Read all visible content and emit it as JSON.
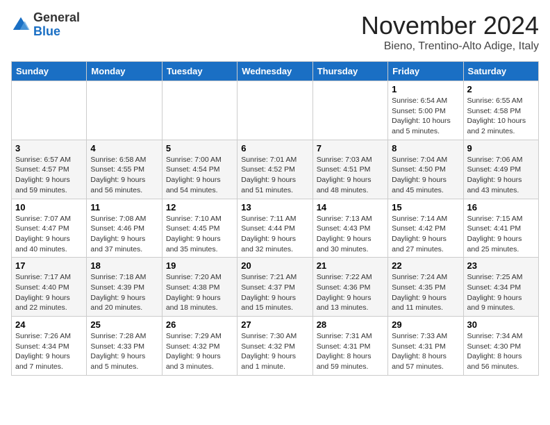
{
  "logo": {
    "general": "General",
    "blue": "Blue"
  },
  "header": {
    "month": "November 2024",
    "location": "Bieno, Trentino-Alto Adige, Italy"
  },
  "days_of_week": [
    "Sunday",
    "Monday",
    "Tuesday",
    "Wednesday",
    "Thursday",
    "Friday",
    "Saturday"
  ],
  "weeks": [
    [
      {
        "day": "",
        "info": ""
      },
      {
        "day": "",
        "info": ""
      },
      {
        "day": "",
        "info": ""
      },
      {
        "day": "",
        "info": ""
      },
      {
        "day": "",
        "info": ""
      },
      {
        "day": "1",
        "info": "Sunrise: 6:54 AM\nSunset: 5:00 PM\nDaylight: 10 hours and 5 minutes."
      },
      {
        "day": "2",
        "info": "Sunrise: 6:55 AM\nSunset: 4:58 PM\nDaylight: 10 hours and 2 minutes."
      }
    ],
    [
      {
        "day": "3",
        "info": "Sunrise: 6:57 AM\nSunset: 4:57 PM\nDaylight: 9 hours and 59 minutes."
      },
      {
        "day": "4",
        "info": "Sunrise: 6:58 AM\nSunset: 4:55 PM\nDaylight: 9 hours and 56 minutes."
      },
      {
        "day": "5",
        "info": "Sunrise: 7:00 AM\nSunset: 4:54 PM\nDaylight: 9 hours and 54 minutes."
      },
      {
        "day": "6",
        "info": "Sunrise: 7:01 AM\nSunset: 4:52 PM\nDaylight: 9 hours and 51 minutes."
      },
      {
        "day": "7",
        "info": "Sunrise: 7:03 AM\nSunset: 4:51 PM\nDaylight: 9 hours and 48 minutes."
      },
      {
        "day": "8",
        "info": "Sunrise: 7:04 AM\nSunset: 4:50 PM\nDaylight: 9 hours and 45 minutes."
      },
      {
        "day": "9",
        "info": "Sunrise: 7:06 AM\nSunset: 4:49 PM\nDaylight: 9 hours and 43 minutes."
      }
    ],
    [
      {
        "day": "10",
        "info": "Sunrise: 7:07 AM\nSunset: 4:47 PM\nDaylight: 9 hours and 40 minutes."
      },
      {
        "day": "11",
        "info": "Sunrise: 7:08 AM\nSunset: 4:46 PM\nDaylight: 9 hours and 37 minutes."
      },
      {
        "day": "12",
        "info": "Sunrise: 7:10 AM\nSunset: 4:45 PM\nDaylight: 9 hours and 35 minutes."
      },
      {
        "day": "13",
        "info": "Sunrise: 7:11 AM\nSunset: 4:44 PM\nDaylight: 9 hours and 32 minutes."
      },
      {
        "day": "14",
        "info": "Sunrise: 7:13 AM\nSunset: 4:43 PM\nDaylight: 9 hours and 30 minutes."
      },
      {
        "day": "15",
        "info": "Sunrise: 7:14 AM\nSunset: 4:42 PM\nDaylight: 9 hours and 27 minutes."
      },
      {
        "day": "16",
        "info": "Sunrise: 7:15 AM\nSunset: 4:41 PM\nDaylight: 9 hours and 25 minutes."
      }
    ],
    [
      {
        "day": "17",
        "info": "Sunrise: 7:17 AM\nSunset: 4:40 PM\nDaylight: 9 hours and 22 minutes."
      },
      {
        "day": "18",
        "info": "Sunrise: 7:18 AM\nSunset: 4:39 PM\nDaylight: 9 hours and 20 minutes."
      },
      {
        "day": "19",
        "info": "Sunrise: 7:20 AM\nSunset: 4:38 PM\nDaylight: 9 hours and 18 minutes."
      },
      {
        "day": "20",
        "info": "Sunrise: 7:21 AM\nSunset: 4:37 PM\nDaylight: 9 hours and 15 minutes."
      },
      {
        "day": "21",
        "info": "Sunrise: 7:22 AM\nSunset: 4:36 PM\nDaylight: 9 hours and 13 minutes."
      },
      {
        "day": "22",
        "info": "Sunrise: 7:24 AM\nSunset: 4:35 PM\nDaylight: 9 hours and 11 minutes."
      },
      {
        "day": "23",
        "info": "Sunrise: 7:25 AM\nSunset: 4:34 PM\nDaylight: 9 hours and 9 minutes."
      }
    ],
    [
      {
        "day": "24",
        "info": "Sunrise: 7:26 AM\nSunset: 4:34 PM\nDaylight: 9 hours and 7 minutes."
      },
      {
        "day": "25",
        "info": "Sunrise: 7:28 AM\nSunset: 4:33 PM\nDaylight: 9 hours and 5 minutes."
      },
      {
        "day": "26",
        "info": "Sunrise: 7:29 AM\nSunset: 4:32 PM\nDaylight: 9 hours and 3 minutes."
      },
      {
        "day": "27",
        "info": "Sunrise: 7:30 AM\nSunset: 4:32 PM\nDaylight: 9 hours and 1 minute."
      },
      {
        "day": "28",
        "info": "Sunrise: 7:31 AM\nSunset: 4:31 PM\nDaylight: 8 hours and 59 minutes."
      },
      {
        "day": "29",
        "info": "Sunrise: 7:33 AM\nSunset: 4:31 PM\nDaylight: 8 hours and 57 minutes."
      },
      {
        "day": "30",
        "info": "Sunrise: 7:34 AM\nSunset: 4:30 PM\nDaylight: 8 hours and 56 minutes."
      }
    ]
  ]
}
